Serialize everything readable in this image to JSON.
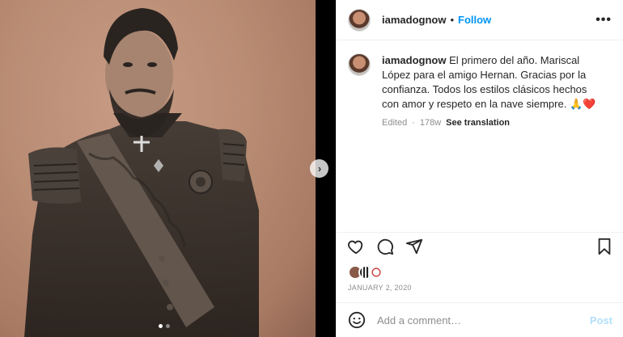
{
  "post": {
    "username": "iamadognow",
    "separator": "•",
    "follow_label": "Follow",
    "more_label": "•••",
    "caption_username": "iamadognow",
    "caption_text": "El primero del año. Mariscal López para el amigo Hernan. Gracias por la confianza. Todos los estilos clásicos hechos con amor y respeto en la nave siempre. 🙏❤️",
    "edited_label": "Edited",
    "age": "178w",
    "translate_label": "See translation",
    "date": "JANUARY 2, 2020",
    "comment_placeholder": "Add a comment…",
    "post_label": "Post"
  },
  "media": {
    "next_label": "›",
    "carousel_count": 2,
    "carousel_active_index": 0
  },
  "icons": {
    "like": "heart-icon",
    "comment": "comment-icon",
    "share": "share-icon",
    "save": "bookmark-icon",
    "emoji": "emoji-icon",
    "next": "chevron-right-icon"
  },
  "colors": {
    "accent": "#0095f6",
    "post_disabled": "#b2dffc",
    "muted": "#8e8e8e"
  }
}
